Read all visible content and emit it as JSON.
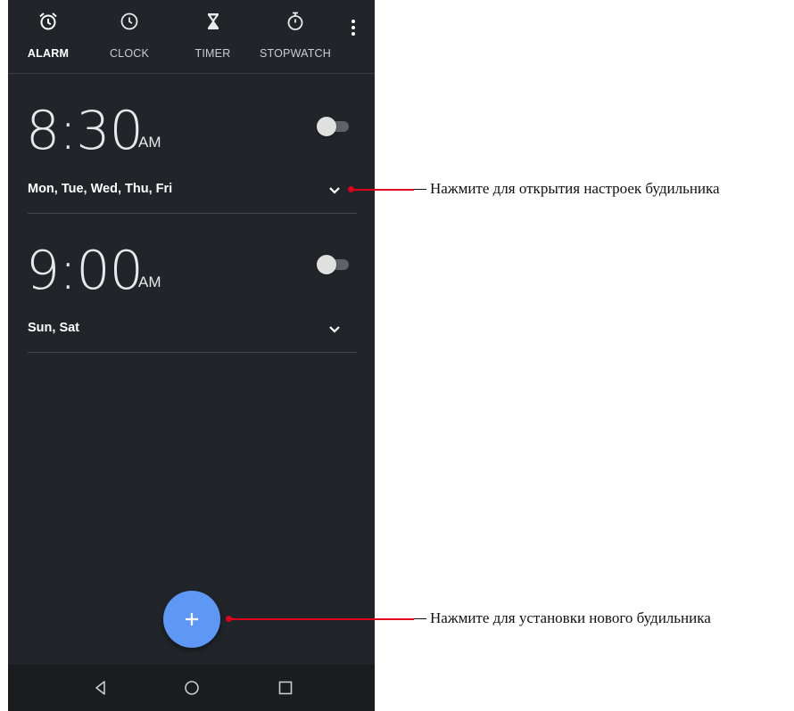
{
  "tabs": [
    {
      "label": "ALARM",
      "icon": "alarm-clock-icon",
      "active": true
    },
    {
      "label": "CLOCK",
      "icon": "clock-icon",
      "active": false
    },
    {
      "label": "TIMER",
      "icon": "hourglass-icon",
      "active": false
    },
    {
      "label": "STOPWATCH",
      "icon": "stopwatch-icon",
      "active": false
    }
  ],
  "overflow_menu_icon": "more-vert-icon",
  "alarms": [
    {
      "time": "8:30",
      "ampm": "AM",
      "days": "Mon, Tue, Wed, Thu, Fri",
      "enabled": false
    },
    {
      "time": "9:00",
      "ampm": "AM",
      "days": "Sun, Sat",
      "enabled": false
    }
  ],
  "fab": {
    "label": "+",
    "icon": "add-icon"
  },
  "navbar": {
    "icons": [
      "back-icon",
      "home-icon",
      "recents-icon"
    ]
  },
  "annotations": [
    {
      "text": "Нажмите для открытия настроек будильника"
    },
    {
      "text": "Нажмите для установки нового будильника"
    }
  ],
  "colors": {
    "background": "#212529",
    "accent": "#5e97f6",
    "callout": "#e0001b"
  }
}
